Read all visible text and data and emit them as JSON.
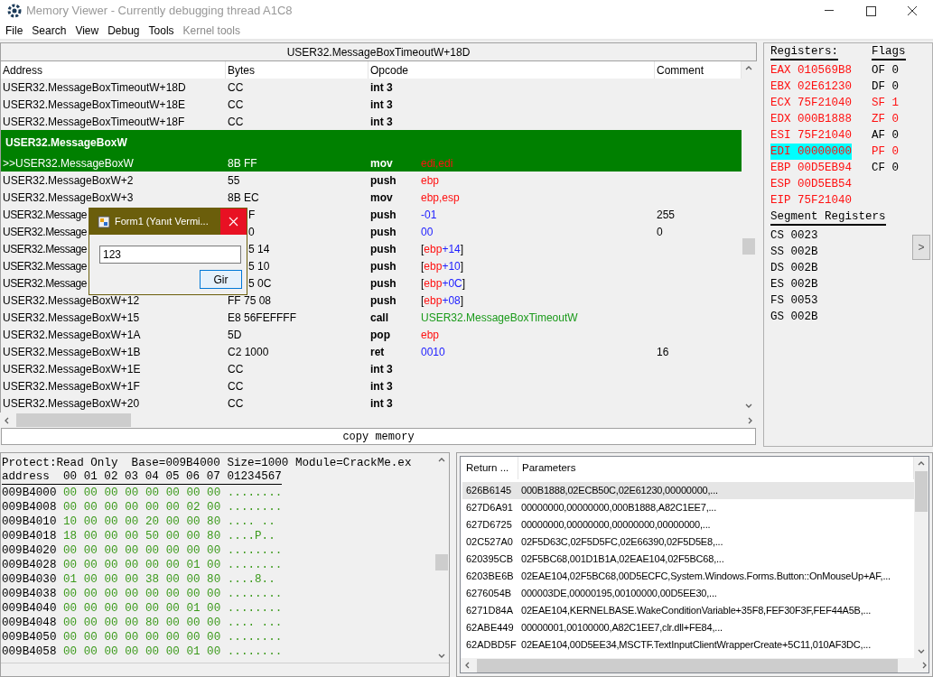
{
  "window": {
    "title": "Memory Viewer - Currently debugging thread A1C8"
  },
  "menu": [
    {
      "label": "File",
      "disabled": false
    },
    {
      "label": "Search",
      "disabled": false
    },
    {
      "label": "View",
      "disabled": false
    },
    {
      "label": "Debug",
      "disabled": false
    },
    {
      "label": "Tools",
      "disabled": false
    },
    {
      "label": "Kernel tools",
      "disabled": true
    }
  ],
  "disassembler": {
    "address_bar": "USER32.MessageBoxTimeoutW+18D",
    "columns": [
      "Address",
      "Bytes",
      "Opcode",
      "Comment"
    ],
    "rows": [
      {
        "kind": "instruction",
        "address": "USER32.MessageBoxTimeoutW+18D",
        "bytes": "CC",
        "opcode": "int 3",
        "selected": false
      },
      {
        "kind": "instruction",
        "address": "USER32.MessageBoxTimeoutW+18E",
        "bytes": "CC",
        "opcode": "int 3",
        "selected": false
      },
      {
        "kind": "instruction",
        "address": "USER32.MessageBoxTimeoutW+18F",
        "bytes": "CC",
        "opcode": "int 3",
        "selected": false
      },
      {
        "kind": "label",
        "text": "USER32.MessageBoxW",
        "selected": true
      },
      {
        "kind": "instruction",
        "address": ">>USER32.MessageBoxW",
        "bytes": "8B FF",
        "opcode": "mov",
        "operand": [
          {
            "kind": "register",
            "text": "edi,edi"
          }
        ],
        "selected": true
      },
      {
        "kind": "instruction",
        "address": "USER32.MessageBoxW+2",
        "bytes": "55",
        "opcode": "push",
        "operand": [
          {
            "kind": "register",
            "text": "ebp"
          }
        ],
        "selected": false
      },
      {
        "kind": "instruction",
        "address": "USER32.MessageBoxW+3",
        "bytes": "8B EC",
        "opcode": "mov",
        "operand": [
          {
            "kind": "register",
            "text": "ebp,esp"
          }
        ],
        "selected": false
      },
      {
        "kind": "covered",
        "address": "USER32.Message",
        "bytes": "F",
        "opcode": "push",
        "operand": [
          {
            "kind": "number",
            "text": "-01"
          }
        ],
        "comment": "255",
        "selected": false
      },
      {
        "kind": "covered",
        "address": "USER32.Message",
        "bytes": "0",
        "opcode": "push",
        "operand": [
          {
            "kind": "number",
            "text": "00"
          }
        ],
        "comment": "0",
        "selected": false
      },
      {
        "kind": "covered",
        "address": "USER32.Message",
        "bytes": "5 14",
        "opcode": "push",
        "operand": [
          {
            "kind": "plain",
            "text": "["
          },
          {
            "kind": "register",
            "text": "ebp"
          },
          {
            "kind": "number",
            "text": "+14"
          },
          {
            "kind": "plain",
            "text": "]"
          }
        ],
        "selected": false
      },
      {
        "kind": "covered",
        "address": "USER32.Message",
        "bytes": "5 10",
        "opcode": "push",
        "operand": [
          {
            "kind": "plain",
            "text": "["
          },
          {
            "kind": "register",
            "text": "ebp"
          },
          {
            "kind": "number",
            "text": "+10"
          },
          {
            "kind": "plain",
            "text": "]"
          }
        ],
        "selected": false
      },
      {
        "kind": "covered",
        "address": "USER32.Message",
        "bytes": "5 0C",
        "opcode": "push",
        "operand": [
          {
            "kind": "plain",
            "text": "["
          },
          {
            "kind": "register",
            "text": "ebp"
          },
          {
            "kind": "number",
            "text": "+0C"
          },
          {
            "kind": "plain",
            "text": "]"
          }
        ],
        "selected": false
      },
      {
        "kind": "instruction",
        "address": "USER32.MessageBoxW+12",
        "bytes": "FF 75 08",
        "opcode": "push",
        "operand": [
          {
            "kind": "plain",
            "text": "["
          },
          {
            "kind": "register",
            "text": "ebp"
          },
          {
            "kind": "number",
            "text": "+08"
          },
          {
            "kind": "plain",
            "text": "]"
          }
        ],
        "selected": false
      },
      {
        "kind": "instruction",
        "address": "USER32.MessageBoxW+15",
        "bytes": "E8 56FEFFFF",
        "opcode": "call",
        "operand": [
          {
            "kind": "symbol",
            "text": "USER32.MessageBoxTimeoutW"
          }
        ],
        "selected": false
      },
      {
        "kind": "instruction",
        "address": "USER32.MessageBoxW+1A",
        "bytes": "5D",
        "opcode": "pop",
        "operand": [
          {
            "kind": "register",
            "text": "ebp"
          }
        ],
        "selected": false
      },
      {
        "kind": "instruction",
        "address": "USER32.MessageBoxW+1B",
        "bytes": "C2 1000",
        "opcode": "ret",
        "operand": [
          {
            "kind": "number",
            "text": "0010"
          }
        ],
        "comment": "16",
        "selected": false
      },
      {
        "kind": "instruction",
        "address": "USER32.MessageBoxW+1E",
        "bytes": "CC",
        "opcode": "int 3",
        "selected": false
      },
      {
        "kind": "instruction",
        "address": "USER32.MessageBoxW+1F",
        "bytes": "CC",
        "opcode": "int 3",
        "selected": false
      },
      {
        "kind": "instruction",
        "address": "USER32.MessageBoxW+20",
        "bytes": "CC",
        "opcode": "int 3",
        "selected": false
      }
    ],
    "button": "copy memory"
  },
  "dialog": {
    "title": "Form1 (Yanıt Vermi...",
    "input_value": "123",
    "button": "Gir"
  },
  "registers": {
    "heading": "Registers:",
    "items": [
      {
        "name": "EAX",
        "value": "010569B8",
        "changed": true,
        "selected": false
      },
      {
        "name": "EBX",
        "value": "02E61230",
        "changed": true,
        "selected": false
      },
      {
        "name": "ECX",
        "value": "75F21040",
        "changed": true,
        "selected": false
      },
      {
        "name": "EDX",
        "value": "000B1888",
        "changed": true,
        "selected": false
      },
      {
        "name": "ESI",
        "value": "75F21040",
        "changed": true,
        "selected": false
      },
      {
        "name": "EDI",
        "value": "00000000",
        "changed": true,
        "selected": true
      },
      {
        "name": "EBP",
        "value": "00D5EB94",
        "changed": true,
        "selected": false
      },
      {
        "name": "ESP",
        "value": "00D5EB54",
        "changed": true,
        "selected": false
      },
      {
        "name": "EIP",
        "value": "75F21040",
        "changed": true,
        "selected": false
      }
    ]
  },
  "flags": {
    "heading": "Flags",
    "items": [
      {
        "name": "OF",
        "value": "0",
        "changed": false
      },
      {
        "name": "DF",
        "value": "0",
        "changed": false
      },
      {
        "name": "SF",
        "value": "1",
        "changed": true
      },
      {
        "name": "ZF",
        "value": "0",
        "changed": true
      },
      {
        "name": "AF",
        "value": "0",
        "changed": false
      },
      {
        "name": "PF",
        "value": "0",
        "changed": true
      },
      {
        "name": "CF",
        "value": "0",
        "changed": false
      }
    ]
  },
  "segment_registers": {
    "heading": "Segment Registers",
    "items": [
      {
        "name": "CS",
        "value": "0023"
      },
      {
        "name": "SS",
        "value": "002B"
      },
      {
        "name": "DS",
        "value": "002B"
      },
      {
        "name": "ES",
        "value": "002B"
      },
      {
        "name": "FS",
        "value": "0053"
      },
      {
        "name": "GS",
        "value": "002B"
      }
    ]
  },
  "panel_toggle": ">",
  "hex_view": {
    "info": "Protect:Read Only  Base=009B4000 Size=1000 Module=CrackMe.ex",
    "header": "address  00 01 02 03 04 05 06 07 01234567",
    "rows": [
      {
        "address": "009B4000",
        "bytes": [
          "00",
          "00",
          "00",
          "00",
          "00",
          "00",
          "00",
          "00"
        ],
        "ascii": "........"
      },
      {
        "address": "009B4008",
        "bytes": [
          "00",
          "00",
          "00",
          "00",
          "00",
          "00",
          "02",
          "00"
        ],
        "ascii": "........"
      },
      {
        "address": "009B4010",
        "bytes": [
          "10",
          "00",
          "00",
          "00",
          "20",
          "00",
          "00",
          "80"
        ],
        "ascii": ".... .."
      },
      {
        "address": "009B4018",
        "bytes": [
          "18",
          "00",
          "00",
          "00",
          "50",
          "00",
          "00",
          "80"
        ],
        "ascii": "....P.."
      },
      {
        "address": "009B4020",
        "bytes": [
          "00",
          "00",
          "00",
          "00",
          "00",
          "00",
          "00",
          "00"
        ],
        "ascii": "........"
      },
      {
        "address": "009B4028",
        "bytes": [
          "00",
          "00",
          "00",
          "00",
          "00",
          "00",
          "01",
          "00"
        ],
        "ascii": "........"
      },
      {
        "address": "009B4030",
        "bytes": [
          "01",
          "00",
          "00",
          "00",
          "38",
          "00",
          "00",
          "80"
        ],
        "ascii": "....8.."
      },
      {
        "address": "009B4038",
        "bytes": [
          "00",
          "00",
          "00",
          "00",
          "00",
          "00",
          "00",
          "00"
        ],
        "ascii": "........"
      },
      {
        "address": "009B4040",
        "bytes": [
          "00",
          "00",
          "00",
          "00",
          "00",
          "00",
          "01",
          "00"
        ],
        "ascii": "........"
      },
      {
        "address": "009B4048",
        "bytes": [
          "00",
          "00",
          "00",
          "00",
          "80",
          "00",
          "00",
          "00"
        ],
        "ascii": ".... ..."
      },
      {
        "address": "009B4050",
        "bytes": [
          "00",
          "00",
          "00",
          "00",
          "00",
          "00",
          "00",
          "00"
        ],
        "ascii": "........"
      },
      {
        "address": "009B4058",
        "bytes": [
          "00",
          "00",
          "00",
          "00",
          "00",
          "00",
          "01",
          "00"
        ],
        "ascii": "........"
      }
    ]
  },
  "stack_trace": {
    "columns": [
      "Return ...",
      "Parameters"
    ],
    "rows": [
      {
        "return": "626B6145",
        "parameters": "000B1888,02ECB50C,02E61230,00000000,...",
        "selected": true
      },
      {
        "return": "627D6A91",
        "parameters": "00000000,00000000,000B1888,A82C1EE7,...",
        "selected": false
      },
      {
        "return": "627D6725",
        "parameters": "00000000,00000000,00000000,00000000,...",
        "selected": false
      },
      {
        "return": "02C527A0",
        "parameters": "02F5D63C,02F5D5FC,02E66390,02F5D5E8,...",
        "selected": false
      },
      {
        "return": "620395CB",
        "parameters": "02F5BC68,001D1B1A,02EAE104,02F5BC68,...",
        "selected": false
      },
      {
        "return": "6203BE6B",
        "parameters": "02EAE104,02F5BC68,00D5ECFC,System.Windows.Forms.Button::OnMouseUp+AF,...",
        "selected": false
      },
      {
        "return": "6276054B",
        "parameters": "000003DE,00000195,00100000,00D5EE30,...",
        "selected": false
      },
      {
        "return": "6271D84A",
        "parameters": "02EAE104,KERNELBASE.WakeConditionVariable+35F8,FEF30F3F,FEF44A5B,...",
        "selected": false
      },
      {
        "return": "62ABE449",
        "parameters": "00000001,00100000,A82C1EE7,clr.dll+FE84,...",
        "selected": false
      },
      {
        "return": "62ADBD5F",
        "parameters": "02EAE104,00D5EE34,MSCTF.TextInputClientWrapperCreate+5C11,010AF3DC,...",
        "selected": false
      }
    ]
  }
}
